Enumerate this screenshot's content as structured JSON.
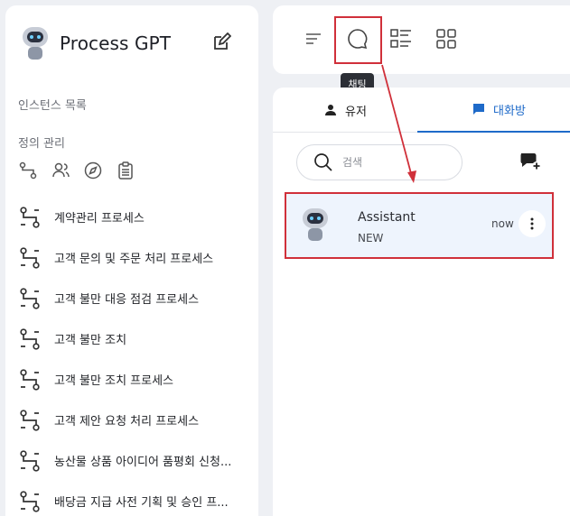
{
  "sidebar": {
    "brand": "Process GPT",
    "instances_label": "인스턴스 목록",
    "definitions_label": "정의 관리",
    "definition_icons": [
      "process-icon",
      "users-icon",
      "compass-icon",
      "clipboard-icon"
    ],
    "processes": [
      {
        "label": "계약관리 프로세스"
      },
      {
        "label": "고객 문의 및 주문 처리 프로세스"
      },
      {
        "label": "고객 불만 대응 점검 프로세스"
      },
      {
        "label": "고객 불만 조치"
      },
      {
        "label": "고객 불만 조치 프로세스"
      },
      {
        "label": "고객 제안 요청 처리 프로세스"
      },
      {
        "label": "농산물 상품 아이디어 품평회 신청..."
      },
      {
        "label": "배당금 지급 사전 기획 및 승인 프..."
      }
    ]
  },
  "toolbar": {
    "buttons": [
      "menu-icon",
      "chat-icon",
      "list-icon",
      "grid-icon"
    ],
    "tooltip": "채팅"
  },
  "chat": {
    "tabs": [
      {
        "label": "유저",
        "icon": "person-icon"
      },
      {
        "label": "대화방",
        "icon": "chat-bubble-icon",
        "active": true
      }
    ],
    "search_placeholder": "검색",
    "rooms": [
      {
        "name": "Assistant",
        "subtitle": "NEW",
        "time": "now"
      }
    ]
  },
  "colors": {
    "accent": "#1e6ac9",
    "highlight": "#d0303a",
    "selected_row": "#eef4fd"
  }
}
